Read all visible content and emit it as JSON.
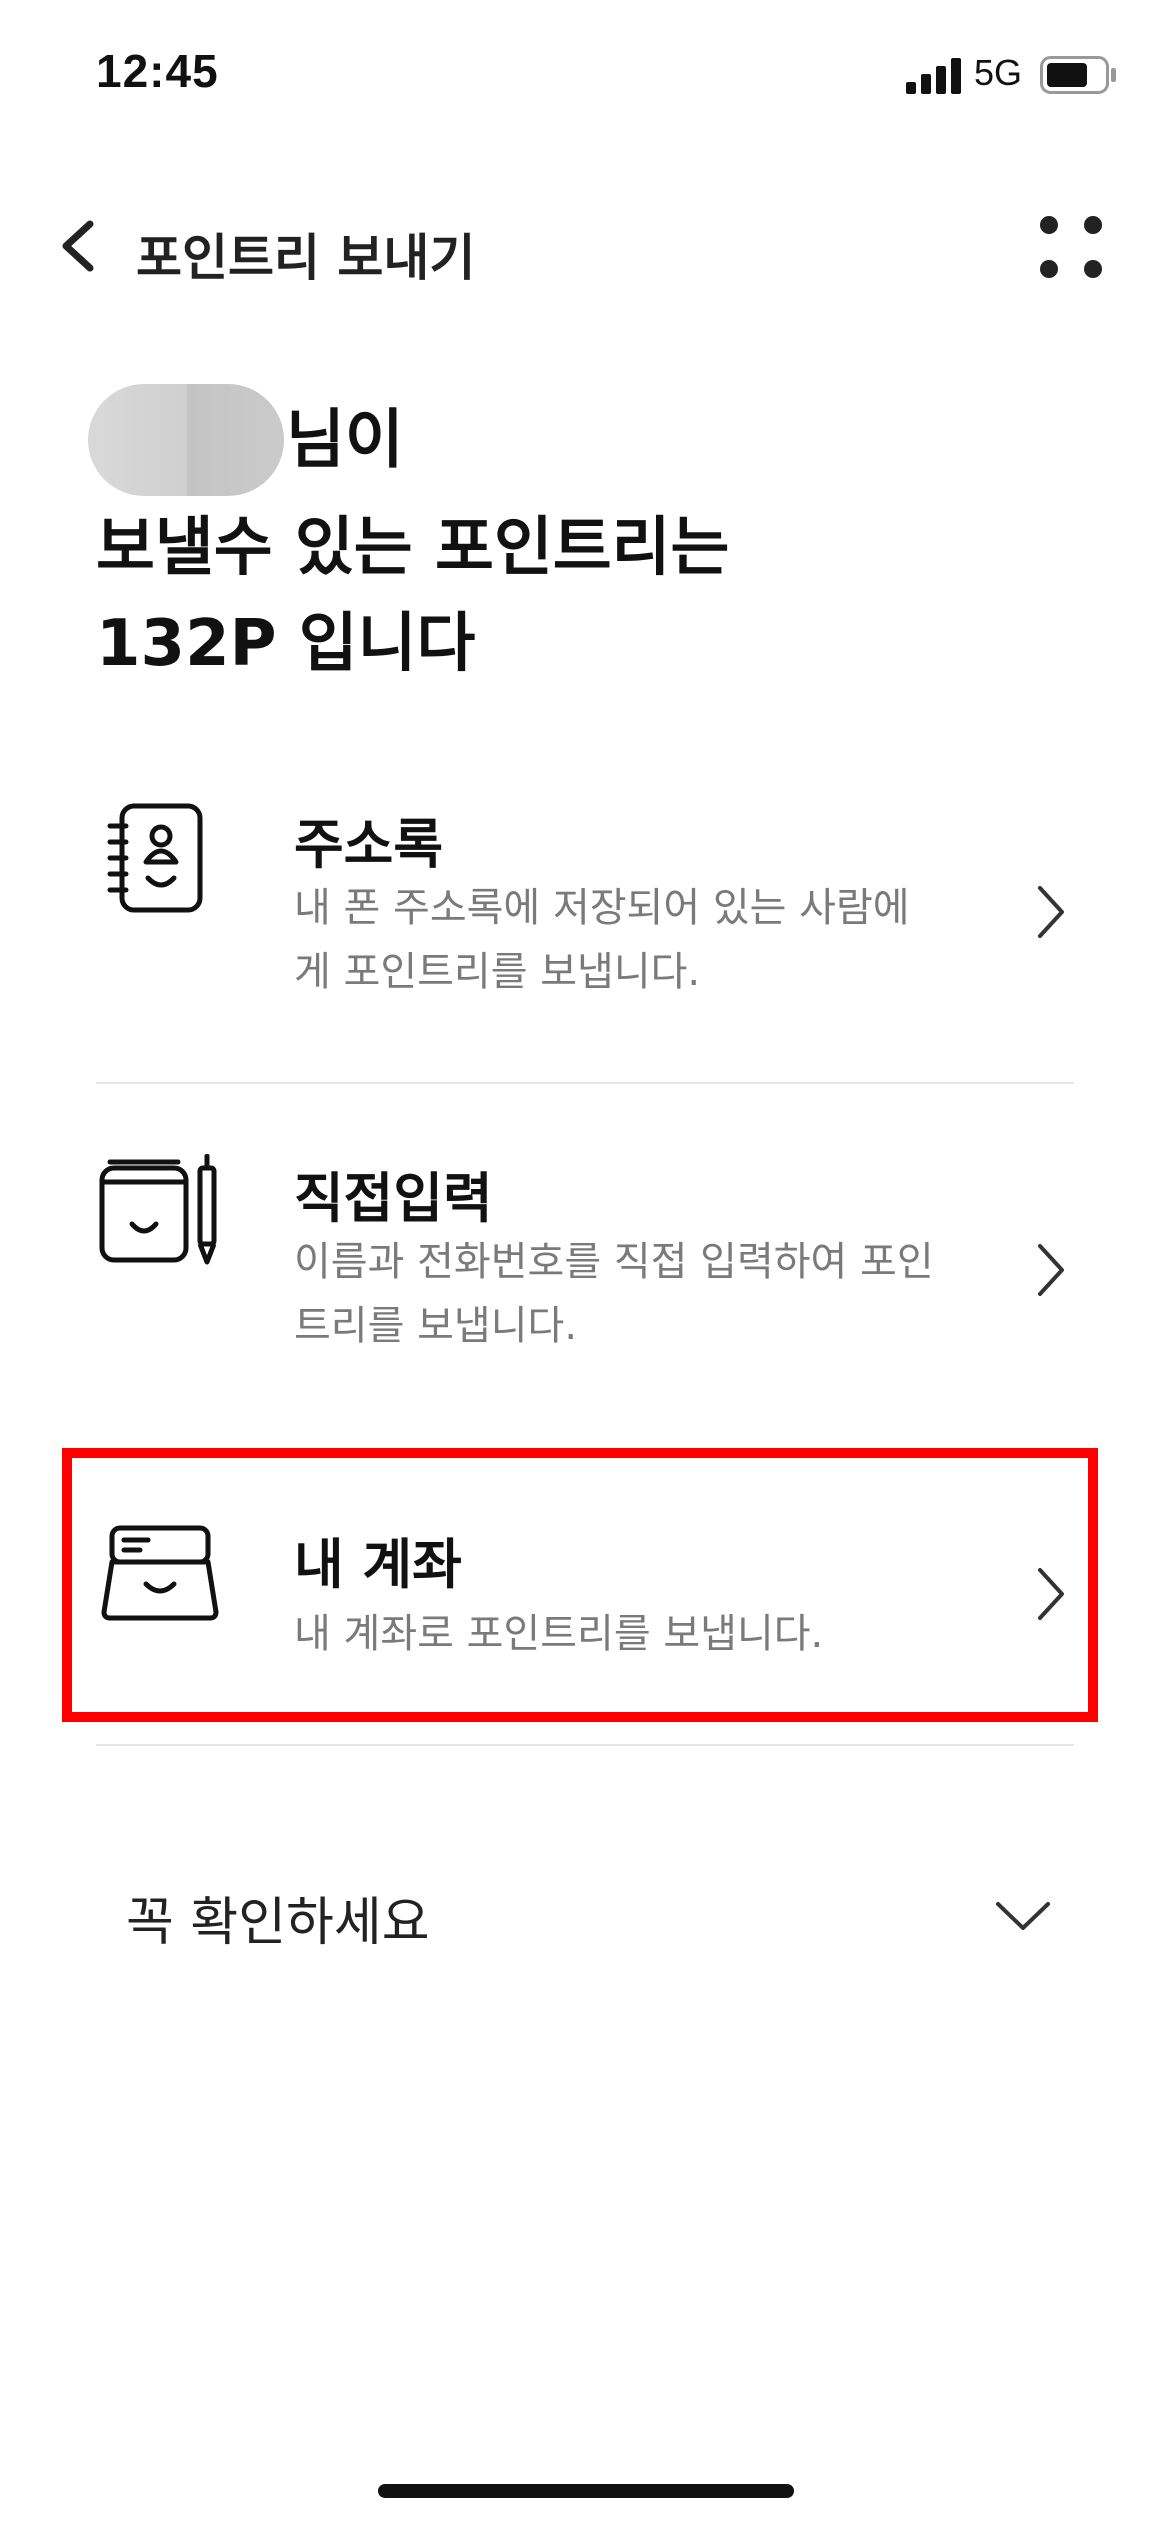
{
  "status_bar": {
    "time": "12:45",
    "network": "5G",
    "icons": [
      "signal-icon",
      "battery-icon"
    ]
  },
  "header": {
    "title": "포인트리 보내기",
    "icons": [
      "back-icon",
      "more-icon"
    ]
  },
  "headline": {
    "line1_suffix": "님이",
    "line2": "보낼수 있는 포인트리는",
    "line3": "132P 입니다"
  },
  "options": [
    {
      "icon": "contact-book-icon",
      "title": "주소록",
      "description": "내 폰 주소록에 저장되어 있는 사람에게 포인트리를 보냅니다."
    },
    {
      "icon": "notepad-pen-icon",
      "title": "직접입력",
      "description": "이름과 전화번호를 직접 입력하여 포인트리를 보냅니다."
    },
    {
      "icon": "bank-card-icon",
      "title": "내 계좌",
      "description": "내 계좌로 포인트리를 보냅니다.",
      "highlighted": true
    }
  ],
  "notice": {
    "label": "꼭 확인하세요",
    "icon": "chevron-down-icon"
  },
  "colors": {
    "text_primary": "#111111",
    "text_secondary": "#7a7a7a",
    "divider": "#e6e6e6",
    "highlight": "#ff0000"
  }
}
